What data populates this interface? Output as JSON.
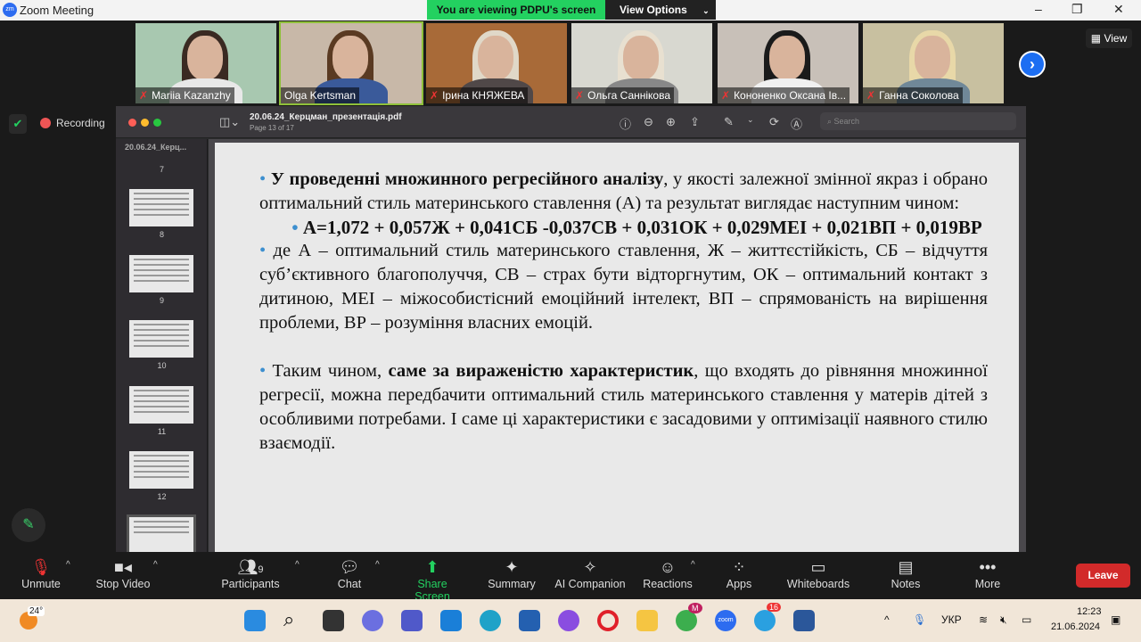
{
  "window": {
    "title": "Zoom Meeting",
    "logo": "zm"
  },
  "banner": {
    "viewing": "You are viewing PDPU's screen",
    "view_options": "View Options"
  },
  "participants_strip": [
    {
      "name": "Mariia Kazanzhy",
      "muted": true
    },
    {
      "name": "Olga Kertsman",
      "muted": false,
      "active": true
    },
    {
      "name": "Ірина КНЯЖЕВА",
      "muted": true
    },
    {
      "name": "Ольга Саннікова",
      "muted": true
    },
    {
      "name": "Кононенко Оксана Ів...",
      "muted": true
    },
    {
      "name": "Ганна Соколова",
      "muted": true
    }
  ],
  "view_label": "View",
  "recording_label": "Recording",
  "pdf": {
    "filename": "20.06.24_Керцман_презентація.pdf",
    "page_info": "Page 13 of 17",
    "search_placeholder": "Search",
    "sidebar_title": "20.06.24_Керц...",
    "thumb_pages": [
      "7",
      "8",
      "9",
      "10",
      "11",
      "12"
    ]
  },
  "slide": {
    "p1_bold": "У проведенні множинного регресійного аналізу",
    "p1_rest": ", у якості залежної змінної якраз і обрано оптимальний стиль материнського ставлення (А) та результат виглядає наступним чином:",
    "formula": "А=1,072 + 0,057Ж + 0,041СБ -0,037СВ + 0,031ОК + 0,029МЕІ + 0,021ВП + 0,019ВР",
    "p2": "де А – оптимальний стиль материнського ставлення, Ж – життєстійкість, СБ – відчуття суб’єктивного благополуччя, СВ – страх бути відторгнутим, ОК – оптимальний контакт з дитиною, МЕІ – міжособистісний емоційний інтелект, ВП – спрямованість на вирішення проблеми, ВР – розуміння власних емоцій.",
    "p3_start": "Таким чином, ",
    "p3_bold": "саме за вираженістю характеристик",
    "p3_rest": ", що входять до рівняння множинної регресії, можна передбачити оптимальний стиль материнського ставлення у матерів дітей з особливими потребами. І саме ці характеристики є засадовими у оптимізації наявного стилю взаємодії."
  },
  "toolbar": {
    "unmute": "Unmute",
    "stop_video": "Stop Video",
    "participants": "Participants",
    "participants_count": "9",
    "chat": "Chat",
    "share_screen": "Share Screen",
    "summary": "Summary",
    "ai_companion": "AI Companion",
    "reactions": "Reactions",
    "apps": "Apps",
    "whiteboards": "Whiteboards",
    "notes": "Notes",
    "more": "More",
    "leave": "Leave"
  },
  "taskbar": {
    "weather": "24°",
    "lang": "УКР",
    "time": "12:23",
    "date": "21.06.2024",
    "chrome_badge": "M",
    "telegram_badge": "16",
    "zoom_label": "zoom"
  },
  "colors": {
    "share_green": "#23d160",
    "leave_red": "#d22a2a",
    "accent_blue": "#1c6ef2"
  }
}
